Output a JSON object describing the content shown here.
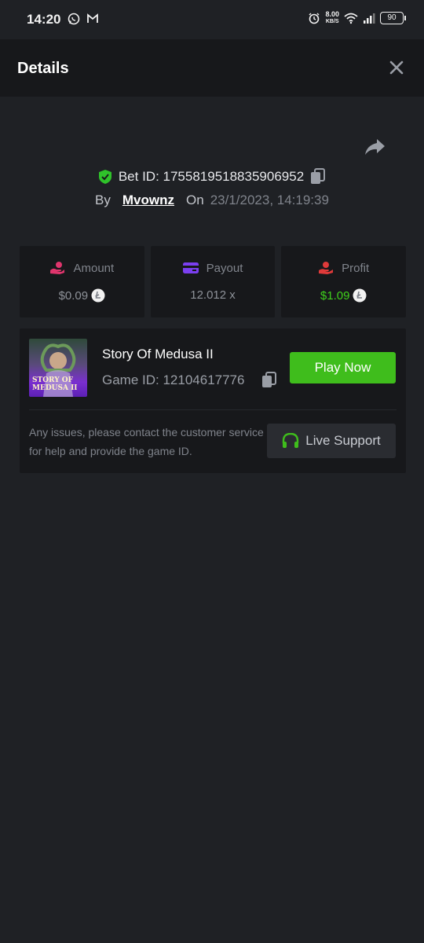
{
  "status_bar": {
    "time": "14:20",
    "left_icons": [
      "whatsapp-icon",
      "gmail-icon"
    ],
    "speed_value": "8.00",
    "speed_unit": "KB/S",
    "battery": "90"
  },
  "header": {
    "title": "Details",
    "close_icon": "close-icon"
  },
  "bet": {
    "id_label": "Bet ID: 1755819518835906952",
    "by_label": "By",
    "username": "Mvownz",
    "on_label": "On",
    "date": "23/1/2023, 14:19:39"
  },
  "stats": [
    {
      "label": "Amount",
      "value": "$0.09",
      "icon": "money-hand-icon",
      "icon_color": "#e0356d"
    },
    {
      "label": "Payout",
      "value": "12.012 x",
      "icon": "credit-card-icon",
      "icon_color": "#7b3ff0"
    },
    {
      "label": "Profit",
      "value": "$1.09",
      "icon": "profit-hand-icon",
      "icon_color": "#e03a3a"
    }
  ],
  "game": {
    "title": "Story Of Medusa II",
    "id_label": "Game ID: 12104617776",
    "thumb_text": "STORY OF MEDUSA II",
    "play_label": "Play Now",
    "support_text": "Any issues, please contact the customer service for help and provide the game ID.",
    "support_label": "Live Support"
  },
  "colors": {
    "background": "#1f2125",
    "card": "#17181b",
    "accent_green": "#3fbd1c",
    "profit_green": "#3fcf1c"
  }
}
